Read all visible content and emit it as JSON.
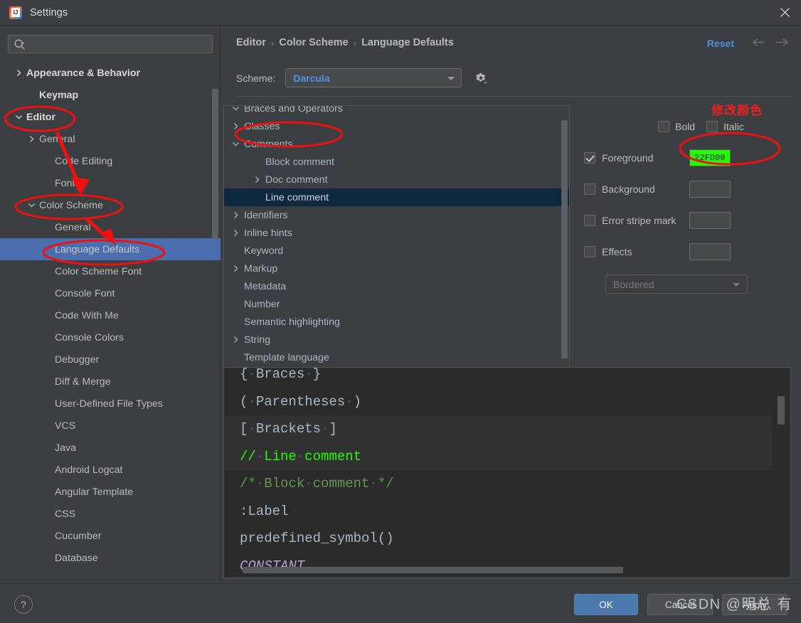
{
  "window": {
    "title": "Settings",
    "logo_icon": "intellij-idea-logo",
    "close_icon": "close-icon"
  },
  "sidebar": {
    "search": {
      "placeholder": "",
      "value": "",
      "icon": "search-icon"
    },
    "items": [
      {
        "label": "Appearance & Behavior",
        "arrow": "right",
        "indent": 0,
        "bold": true,
        "selected": false
      },
      {
        "label": "Keymap",
        "arrow": "none",
        "indent": 1,
        "bold": true,
        "selected": false
      },
      {
        "label": "Editor",
        "arrow": "down",
        "indent": 0,
        "bold": true,
        "selected": false
      },
      {
        "label": "General",
        "arrow": "right",
        "indent": 1,
        "bold": false,
        "selected": false
      },
      {
        "label": "Code Editing",
        "arrow": "none",
        "indent": 2,
        "bold": false,
        "selected": false
      },
      {
        "label": "Font",
        "arrow": "none",
        "indent": 2,
        "bold": false,
        "selected": false
      },
      {
        "label": "Color Scheme",
        "arrow": "down",
        "indent": 1,
        "bold": false,
        "selected": false
      },
      {
        "label": "General",
        "arrow": "none",
        "indent": 3,
        "bold": false,
        "selected": false
      },
      {
        "label": "Language Defaults",
        "arrow": "none",
        "indent": 3,
        "bold": false,
        "selected": true
      },
      {
        "label": "Color Scheme Font",
        "arrow": "none",
        "indent": 3,
        "bold": false,
        "selected": false
      },
      {
        "label": "Console Font",
        "arrow": "none",
        "indent": 3,
        "bold": false,
        "selected": false
      },
      {
        "label": "Code With Me",
        "arrow": "none",
        "indent": 3,
        "bold": false,
        "selected": false
      },
      {
        "label": "Console Colors",
        "arrow": "none",
        "indent": 3,
        "bold": false,
        "selected": false
      },
      {
        "label": "Debugger",
        "arrow": "none",
        "indent": 3,
        "bold": false,
        "selected": false
      },
      {
        "label": "Diff & Merge",
        "arrow": "none",
        "indent": 3,
        "bold": false,
        "selected": false
      },
      {
        "label": "User-Defined File Types",
        "arrow": "none",
        "indent": 3,
        "bold": false,
        "selected": false
      },
      {
        "label": "VCS",
        "arrow": "none",
        "indent": 3,
        "bold": false,
        "selected": false
      },
      {
        "label": "Java",
        "arrow": "none",
        "indent": 3,
        "bold": false,
        "selected": false
      },
      {
        "label": "Android Logcat",
        "arrow": "none",
        "indent": 3,
        "bold": false,
        "selected": false
      },
      {
        "label": "Angular Template",
        "arrow": "none",
        "indent": 3,
        "bold": false,
        "selected": false
      },
      {
        "label": "CSS",
        "arrow": "none",
        "indent": 3,
        "bold": false,
        "selected": false
      },
      {
        "label": "Cucumber",
        "arrow": "none",
        "indent": 3,
        "bold": false,
        "selected": false
      },
      {
        "label": "Database",
        "arrow": "none",
        "indent": 3,
        "bold": false,
        "selected": false
      }
    ]
  },
  "header": {
    "breadcrumb": [
      "Editor",
      "Color Scheme",
      "Language Defaults"
    ],
    "separator": "›",
    "reset_label": "Reset",
    "back_icon": "arrow-left-icon",
    "forward_icon": "arrow-right-icon"
  },
  "scheme": {
    "label": "Scheme:",
    "value": "Darcula",
    "gear_icon": "gear-icon",
    "options": [
      "Darcula"
    ]
  },
  "scheme_tree": {
    "items": [
      {
        "label": "Braces and Operators",
        "arrow": "down",
        "indent": 0,
        "selected": false
      },
      {
        "label": "Classes",
        "arrow": "right",
        "indent": 0,
        "selected": false
      },
      {
        "label": "Comments",
        "arrow": "down",
        "indent": 0,
        "selected": false
      },
      {
        "label": "Block comment",
        "arrow": "none",
        "indent": 1,
        "selected": false
      },
      {
        "label": "Doc comment",
        "arrow": "right",
        "indent": 1,
        "selected": false
      },
      {
        "label": "Line comment",
        "arrow": "none",
        "indent": 1,
        "selected": true
      },
      {
        "label": "Identifiers",
        "arrow": "right",
        "indent": 0,
        "selected": false
      },
      {
        "label": "Inline hints",
        "arrow": "right",
        "indent": 0,
        "selected": false
      },
      {
        "label": "Keyword",
        "arrow": "none",
        "indent": 0,
        "selected": false
      },
      {
        "label": "Markup",
        "arrow": "right",
        "indent": 0,
        "selected": false
      },
      {
        "label": "Metadata",
        "arrow": "none",
        "indent": 0,
        "selected": false
      },
      {
        "label": "Number",
        "arrow": "none",
        "indent": 0,
        "selected": false
      },
      {
        "label": "Semantic highlighting",
        "arrow": "none",
        "indent": 0,
        "selected": false
      },
      {
        "label": "String",
        "arrow": "right",
        "indent": 0,
        "selected": false
      },
      {
        "label": "Template language",
        "arrow": "none",
        "indent": 0,
        "selected": false
      }
    ]
  },
  "options": {
    "bold": {
      "label": "Bold",
      "checked": false
    },
    "italic": {
      "label": "Italic",
      "checked": false
    },
    "rows": [
      {
        "label": "Foreground",
        "checked": true,
        "color": "22FD00",
        "has_color": true
      },
      {
        "label": "Background",
        "checked": false,
        "color": "",
        "has_color": false
      },
      {
        "label": "Error stripe mark",
        "checked": false,
        "color": "",
        "has_color": false
      },
      {
        "label": "Effects",
        "checked": false,
        "color": "",
        "has_color": false
      }
    ],
    "effects_select": {
      "value": "Bordered",
      "options": [
        "Bordered"
      ]
    }
  },
  "preview": {
    "lines": [
      {
        "segments": [
          {
            "t": "{ ",
            "c": "#a9b7c6"
          },
          {
            "t": "Braces",
            "c": "#a9b7c6"
          },
          {
            "t": " }",
            "c": "#a9b7c6"
          }
        ],
        "highlight": false
      },
      {
        "segments": [
          {
            "t": "( ",
            "c": "#a9b7c6"
          },
          {
            "t": "Parentheses",
            "c": "#a9b7c6"
          },
          {
            "t": " )",
            "c": "#a9b7c6"
          }
        ],
        "highlight": false
      },
      {
        "segments": [
          {
            "t": "[ ",
            "c": "#a9b7c6"
          },
          {
            "t": "Brackets",
            "c": "#a9b7c6"
          },
          {
            "t": " ]",
            "c": "#a9b7c6"
          }
        ],
        "highlight": true
      },
      {
        "segments": [
          {
            "t": "// Line comment",
            "c": "#22fd00"
          }
        ],
        "highlight": true
      },
      {
        "segments": [
          {
            "t": "/* Block comment */",
            "c": "#629755"
          }
        ],
        "highlight": false
      },
      {
        "segments": [
          {
            "t": ":Label",
            "c": "#a9b7c6"
          }
        ],
        "highlight": false
      },
      {
        "segments": [
          {
            "t": "predefined_symbol()",
            "c": "#a9b7c6"
          }
        ],
        "highlight": false
      },
      {
        "segments": [
          {
            "t": "CONSTANT",
            "c": "#b9a0d4",
            "italic": true
          }
        ],
        "highlight": false
      }
    ]
  },
  "footer": {
    "help_label": "?",
    "ok_label": "OK",
    "cancel_label": "Cancel",
    "apply_label": "Apply"
  },
  "annotations": {
    "modify_color_text": "修改颜色",
    "watermark": "CSDN @明总 有",
    "marker_color": "#ee1111"
  }
}
